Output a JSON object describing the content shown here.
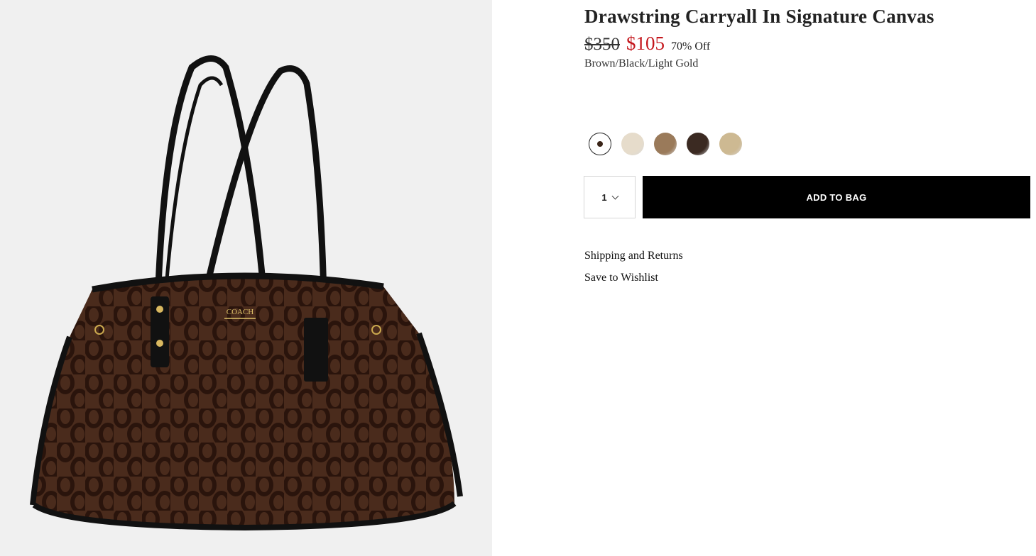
{
  "product": {
    "title": "Drawstring Carryall In Signature Canvas",
    "original_price": "$350",
    "sale_price": "$105",
    "discount": "70% Off",
    "color_name": "Brown/Black/Light Gold",
    "brand_logo_text": "COACH"
  },
  "swatches": [
    {
      "name": "Brown/Black/Light Gold",
      "color": "#3a2418",
      "selected": true
    },
    {
      "name": "swatch-2",
      "color": "#e6dccb",
      "selected": false
    },
    {
      "name": "swatch-3",
      "color": "#9a7a5a",
      "selected": false
    },
    {
      "name": "swatch-4",
      "color": "#3b2a22",
      "selected": false
    },
    {
      "name": "swatch-5",
      "color": "#cdb992",
      "selected": false
    }
  ],
  "purchase": {
    "quantity": "1",
    "add_to_bag_label": "ADD TO BAG"
  },
  "links": {
    "shipping": "Shipping and Returns",
    "wishlist": "Save to Wishlist"
  },
  "colors": {
    "sale_red": "#c4161c",
    "button_black": "#000000",
    "image_bg": "#f0f0f0"
  }
}
